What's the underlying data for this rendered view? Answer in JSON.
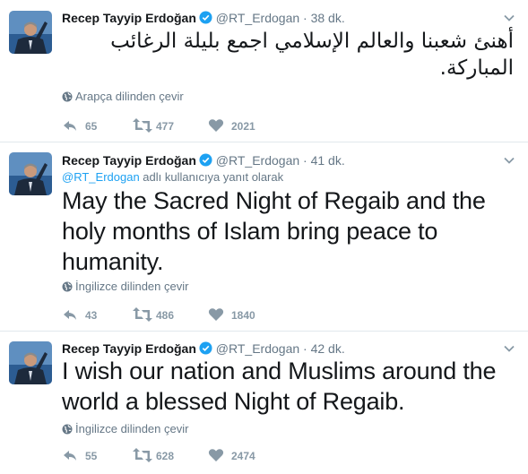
{
  "colors": {
    "link": "#1da1f2",
    "muted": "#657786",
    "action": "#8899a6",
    "verified": "#1da1f2"
  },
  "icons": {
    "verified": "verified-badge-icon",
    "caret": "chevron-down-icon",
    "translate": "globe-icon",
    "reply": "reply-icon",
    "retweet": "retweet-icon",
    "like": "heart-icon"
  },
  "tweets": [
    {
      "fullname": "Recep Tayyip Erdoğan",
      "username": "@RT_Erdogan",
      "separator": "·",
      "time": "38 dk.",
      "text": "أهنئ شعبنا والعالم الإسلامي اجمع بليلة الرغائب المباركة.",
      "translate": "Arapça dilinden çevir",
      "replies": "65",
      "retweets": "477",
      "likes": "2021"
    },
    {
      "fullname": "Recep Tayyip Erdoğan",
      "username": "@RT_Erdogan",
      "separator": "·",
      "time": "41 dk.",
      "reply_mention": "@RT_Erdogan",
      "reply_suffix": "adlı kullanıcıya yanıt olarak",
      "text": "May the Sacred Night of Regaib and the holy months of Islam bring peace to humanity.",
      "translate": "İngilizce dilinden çevir",
      "replies": "43",
      "retweets": "486",
      "likes": "1840"
    },
    {
      "fullname": "Recep Tayyip Erdoğan",
      "username": "@RT_Erdogan",
      "separator": "·",
      "time": "42 dk.",
      "text": "I wish our nation and Muslims around the world a blessed Night of Regaib.",
      "translate": "İngilizce dilinden çevir",
      "replies": "55",
      "retweets": "628",
      "likes": "2474"
    }
  ]
}
